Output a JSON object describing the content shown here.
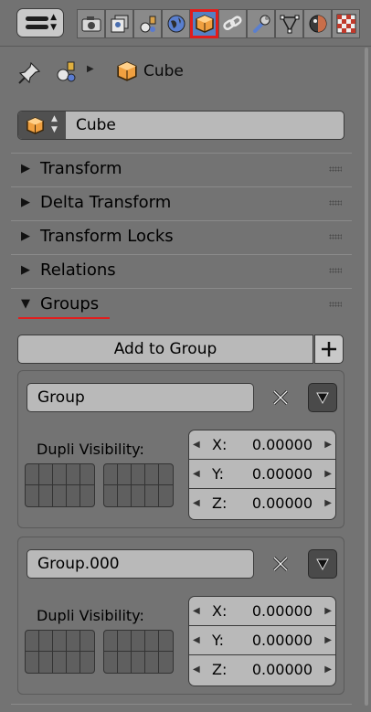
{
  "header": {
    "tabs": [
      {
        "name": "render",
        "icon": "camera-icon"
      },
      {
        "name": "render-layers",
        "icon": "layers-icon"
      },
      {
        "name": "scene",
        "icon": "scene-icon"
      },
      {
        "name": "world",
        "icon": "world-icon"
      },
      {
        "name": "object",
        "icon": "cube-icon",
        "active": true
      },
      {
        "name": "constraints",
        "icon": "chain-link-icon"
      },
      {
        "name": "modifiers",
        "icon": "wrench-icon"
      },
      {
        "name": "data",
        "icon": "vertex-triangle-icon"
      },
      {
        "name": "material",
        "icon": "material-sphere-icon"
      },
      {
        "name": "texture",
        "icon": "checker-texture-icon"
      }
    ]
  },
  "breadcrumb": {
    "object": "Cube"
  },
  "object": {
    "name": "Cube"
  },
  "panels": [
    {
      "label": "Transform",
      "expanded": false
    },
    {
      "label": "Delta Transform",
      "expanded": false
    },
    {
      "label": "Transform Locks",
      "expanded": false
    },
    {
      "label": "Relations",
      "expanded": false
    },
    {
      "label": "Groups",
      "expanded": true
    }
  ],
  "groups_panel": {
    "add_button": "Add to Group",
    "groups": [
      {
        "name": "Group",
        "dupli_label": "Dupli Visibility:",
        "offsets": [
          {
            "axis": "X:",
            "value": "0.00000"
          },
          {
            "axis": "Y:",
            "value": "0.00000"
          },
          {
            "axis": "Z:",
            "value": "0.00000"
          }
        ]
      },
      {
        "name": "Group.000",
        "dupli_label": "Dupli Visibility:",
        "offsets": [
          {
            "axis": "X:",
            "value": "0.00000"
          },
          {
            "axis": "Y:",
            "value": "0.00000"
          },
          {
            "axis": "Z:",
            "value": "0.00000"
          }
        ]
      }
    ]
  },
  "colors": {
    "background": "#737373",
    "active_tab": "#5680c2",
    "highlight_red": "#e11d1d",
    "field": "#b9b9b9",
    "cube_orange": "#f0a040"
  }
}
